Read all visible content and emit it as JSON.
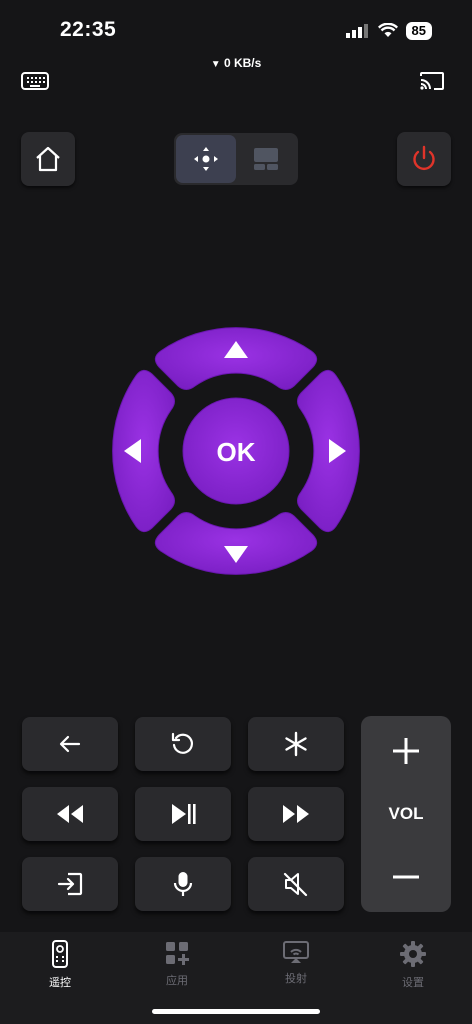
{
  "status_bar": {
    "time": "22:35",
    "battery": "85",
    "network_speed": "0 KB/s"
  },
  "top": {
    "keyboard_icon": "keyboard-icon",
    "cast_icon": "cast-icon"
  },
  "controls": {
    "home_icon": "home-icon",
    "mode_options": [
      "dpad-mode",
      "touchpad-mode"
    ],
    "power_icon": "power-icon",
    "power_color": "#e0342a"
  },
  "dpad": {
    "ok_label": "OK",
    "color": "#8a2ad6"
  },
  "buttons": {
    "row1": [
      "back-icon",
      "replay-icon",
      "options-icon"
    ],
    "row2": [
      "rewind-icon",
      "play-pause-icon",
      "fast-forward-icon"
    ],
    "row3": [
      "input-icon",
      "mic-icon",
      "mute-icon"
    ],
    "vol_label": "VOL"
  },
  "tabs": [
    {
      "label": "遥控",
      "icon": "remote-icon",
      "active": true
    },
    {
      "label": "应用",
      "icon": "apps-icon",
      "active": false
    },
    {
      "label": "投射",
      "icon": "screen-cast-icon",
      "active": false
    },
    {
      "label": "设置",
      "icon": "settings-icon",
      "active": false
    }
  ]
}
